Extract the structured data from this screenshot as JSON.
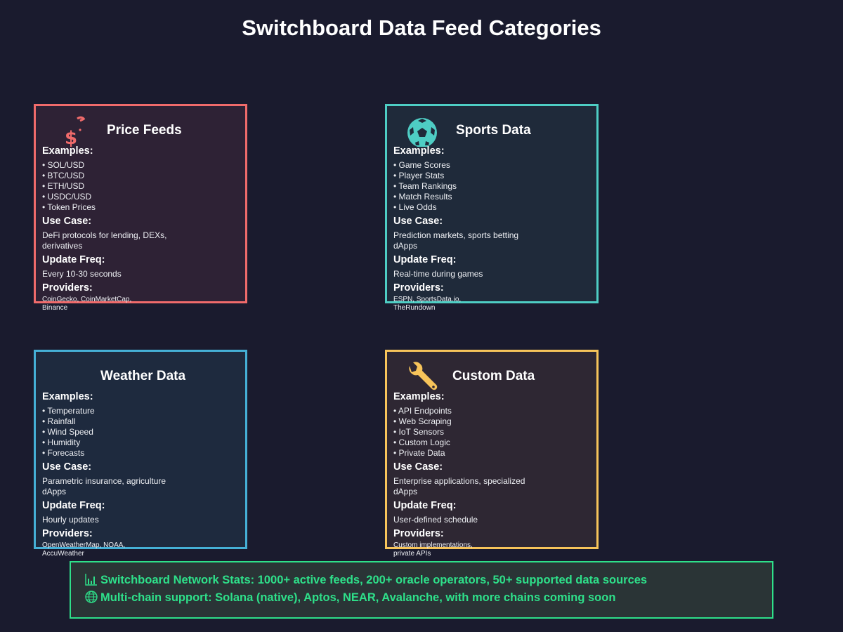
{
  "title": "Switchboard Data Feed Categories",
  "labels": {
    "examples": "Examples:",
    "use_case": "Use Case:",
    "update_freq": "Update Freq:",
    "providers": "Providers:"
  },
  "cards": [
    {
      "name": "Price Feeds",
      "icon": "money-bag-icon",
      "color": "#f06b6b",
      "examples": [
        "• SOL/USD",
        "• BTC/USD",
        "• ETH/USD",
        "• USDC/USD",
        "• Token Prices"
      ],
      "use_case": "DeFi protocols for lending, DEXs, derivatives",
      "update_freq": "Every 10-30 seconds",
      "providers": "CoinGecko, CoinMarketCap, Binance"
    },
    {
      "name": "Sports Data",
      "icon": "soccer-ball-icon",
      "color": "#4ecdc4",
      "examples": [
        "• Game Scores",
        "• Player Stats",
        "• Team Rankings",
        "• Match Results",
        "• Live Odds"
      ],
      "use_case": "Prediction markets, sports betting dApps",
      "update_freq": "Real-time during games",
      "providers": "ESPN, SportsData.io, TheRundown"
    },
    {
      "name": "Weather Data",
      "icon": "",
      "color": "#45b0d6",
      "examples": [
        "• Temperature",
        "• Rainfall",
        "• Wind Speed",
        "• Humidity",
        "• Forecasts"
      ],
      "use_case": "Parametric insurance, agriculture dApps",
      "update_freq": "Hourly updates",
      "providers": "OpenWeatherMap, NOAA, AccuWeather"
    },
    {
      "name": "Custom Data",
      "icon": "wrench-icon",
      "color": "#f7c45a",
      "examples": [
        "• API Endpoints",
        "• Web Scraping",
        "• IoT Sensors",
        "• Custom Logic",
        "• Private Data"
      ],
      "use_case": "Enterprise applications, specialized dApps",
      "update_freq": "User-defined schedule",
      "providers": "Custom implementations, private APIs"
    }
  ],
  "stats": {
    "line1": "Switchboard Network Stats: 1000+ active feeds, 200+ oracle operators, 50+ supported data sources",
    "line2": "Multi-chain support: Solana (native), Aptos, NEAR, Avalanche, with more chains coming soon",
    "icon1": "bar-chart-icon",
    "icon2": "globe-icon",
    "color": "#2ee08a"
  }
}
